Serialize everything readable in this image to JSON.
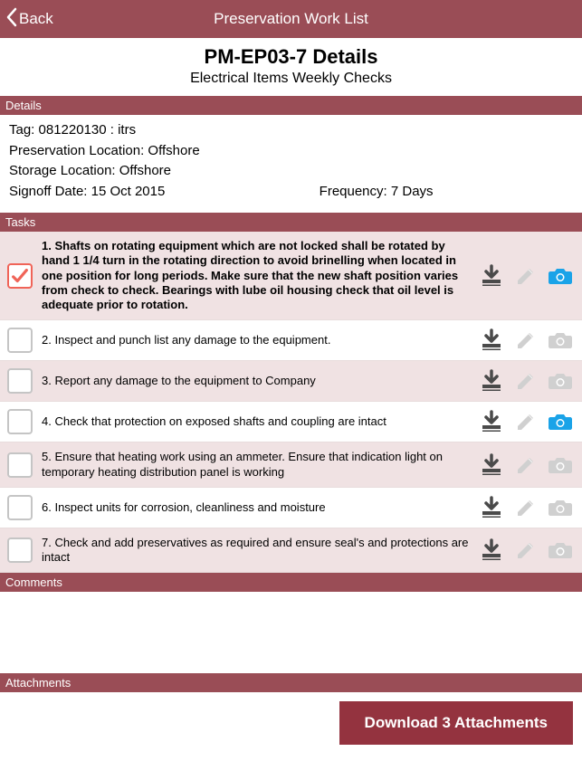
{
  "nav": {
    "back_label": "Back",
    "title": "Preservation Work List"
  },
  "header": {
    "title": "PM-EP03-7 Details",
    "subtitle": "Electrical Items Weekly Checks"
  },
  "sections": {
    "details": "Details",
    "tasks": "Tasks",
    "comments": "Comments",
    "attachments": "Attachments"
  },
  "details": {
    "tag": "Tag: 081220130 : itrs",
    "preservation_location": "Preservation Location: Offshore",
    "storage_location": "Storage Location: Offshore",
    "signoff_date": "Signoff Date: 15 Oct 2015",
    "frequency": "Frequency: 7 Days"
  },
  "tasks": [
    {
      "text": "1. Shafts on rotating equipment which are not locked shall be rotated  by hand 1 1/4 turn in the rotating direction to avoid brinelling when located in one position for long periods. Make sure that the new shaft position varies from check to check. Bearings with lube oil housing check that oil level is adequate prior to rotation.",
      "checked": true,
      "bold": true,
      "camera_active": true,
      "shaded": true
    },
    {
      "text": "2. Inspect and punch list any damage to the equipment.",
      "checked": false,
      "bold": false,
      "camera_active": false,
      "shaded": false
    },
    {
      "text": "3. Report any damage to the equipment to Company",
      "checked": false,
      "bold": false,
      "camera_active": false,
      "shaded": true
    },
    {
      "text": "4. Check that protection on exposed shafts and coupling are intact",
      "checked": false,
      "bold": false,
      "camera_active": true,
      "shaded": false
    },
    {
      "text": "5. Ensure that heating work using an ammeter. Ensure that indication light on temporary heating distribution panel is working",
      "checked": false,
      "bold": false,
      "camera_active": false,
      "shaded": true
    },
    {
      "text": "6. Inspect units for corrosion, cleanliness and moisture",
      "checked": false,
      "bold": false,
      "camera_active": false,
      "shaded": false
    },
    {
      "text": "7. Check and add preservatives as required and ensure seal's and protections are intact",
      "checked": false,
      "bold": false,
      "camera_active": false,
      "shaded": true
    }
  ],
  "footer": {
    "download_label": "Download 3 Attachments"
  },
  "colors": {
    "accent": "#9a4d56",
    "button_accent": "#94333f",
    "check_accent": "#f06458",
    "camera_active": "#1aa3e8",
    "icon_dark": "#4a4a4a",
    "icon_muted": "#d0d0d0"
  }
}
